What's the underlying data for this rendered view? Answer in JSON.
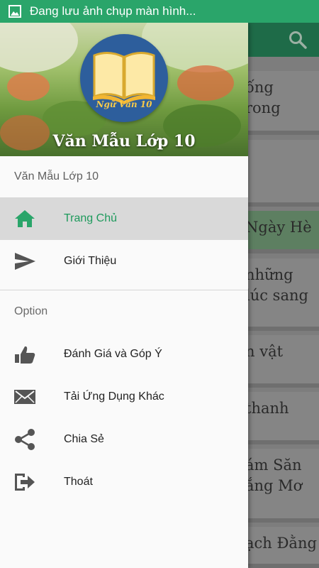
{
  "status_bar": {
    "text": "Đang lưu ảnh chụp màn hình..."
  },
  "background_cards": [
    {
      "lines": [
        "ống",
        "rong"
      ],
      "green": false
    },
    {
      "lines": [
        ""
      ],
      "green": false
    },
    {
      "lines": [
        "Ngày Hè"
      ],
      "green": true
    },
    {
      "lines": [
        "những",
        "lúc sang"
      ],
      "green": false
    },
    {
      "lines": [
        "n vật"
      ],
      "green": false
    },
    {
      "lines": [
        "thanh"
      ],
      "green": false
    },
    {
      "lines": [
        "ám Săn",
        "ắng Mơ"
      ],
      "green": false
    },
    {
      "lines": [
        "ạch Đằng"
      ],
      "green": false
    }
  ],
  "drawer": {
    "logo_text": "Ngữ Văn 10",
    "header_title": "Văn Mẫu Lớp 10",
    "subheader": "Văn Mẫu Lớp 10",
    "menu": [
      {
        "label": "Trang Chủ",
        "icon": "home-icon",
        "active": true
      },
      {
        "label": "Giới Thiệu",
        "icon": "send-icon",
        "active": false
      }
    ],
    "section_title": "Option",
    "options": [
      {
        "label": "Đánh Giá và Góp Ý",
        "icon": "thumbs-up-icon"
      },
      {
        "label": "Tải Ứng Dụng Khác",
        "icon": "mail-icon"
      },
      {
        "label": "Chia Sẻ",
        "icon": "share-icon"
      },
      {
        "label": "Thoát",
        "icon": "exit-icon"
      }
    ]
  },
  "colors": {
    "accent": "#1e9a5c",
    "status_bar": "#2aa56a",
    "toolbar": "#1e6b48"
  }
}
